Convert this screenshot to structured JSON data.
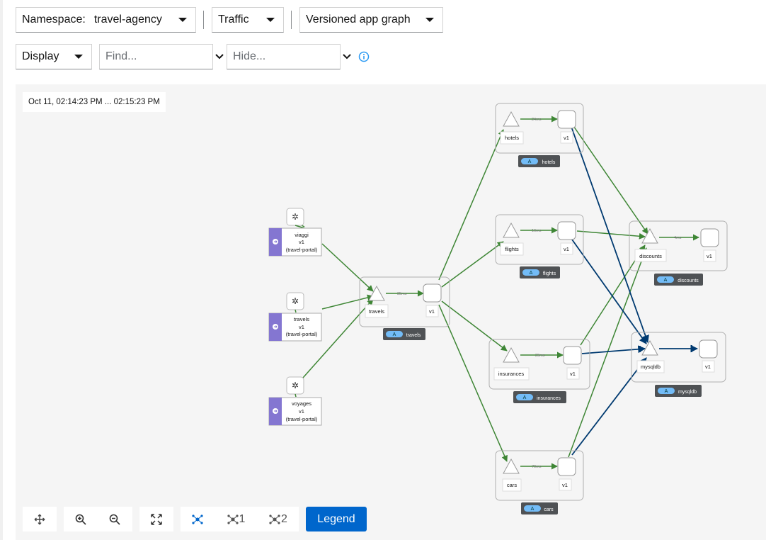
{
  "toolbar": {
    "namespace_label": "Namespace:",
    "namespace_value": "travel-agency",
    "traffic_label": "Traffic",
    "graph_type_label": "Versioned app graph",
    "display_label": "Display",
    "find_placeholder": "Find...",
    "hide_placeholder": "Hide...",
    "info_icon": "info-circle-icon"
  },
  "graph": {
    "timestamp": "Oct 11, 02:14:23 PM ... 02:15:23 PM",
    "badge_letter": "A",
    "version_label": "v1",
    "edge_label_travels": "35ms",
    "edge_label_hotels": "24ms",
    "edge_label_flights": "16ms",
    "edge_label_insurances": "29ms",
    "edge_label_cars": "70ms",
    "edge_label_discounts": "4ms",
    "portals": [
      {
        "name": "viaggi",
        "version": "v1",
        "sub": "(travel-portal)"
      },
      {
        "name": "travels",
        "version": "v1",
        "sub": "(travel-portal)"
      },
      {
        "name": "voyages",
        "version": "v1",
        "sub": "(travel-portal)"
      }
    ],
    "apps": {
      "travels": "travels",
      "hotels": "hotels",
      "flights": "flights",
      "insurances": "insurances",
      "cars": "cars",
      "discounts": "discounts",
      "mysqldb": "mysqldb"
    },
    "colors": {
      "healthy_edge": "#3e8635",
      "tcp_edge": "#003a70",
      "portal": "#8476d1",
      "accent": "#06c"
    }
  },
  "bottom_toolbar": {
    "layout_default": "",
    "layout_1": "1",
    "layout_2": "2",
    "legend": "Legend"
  }
}
